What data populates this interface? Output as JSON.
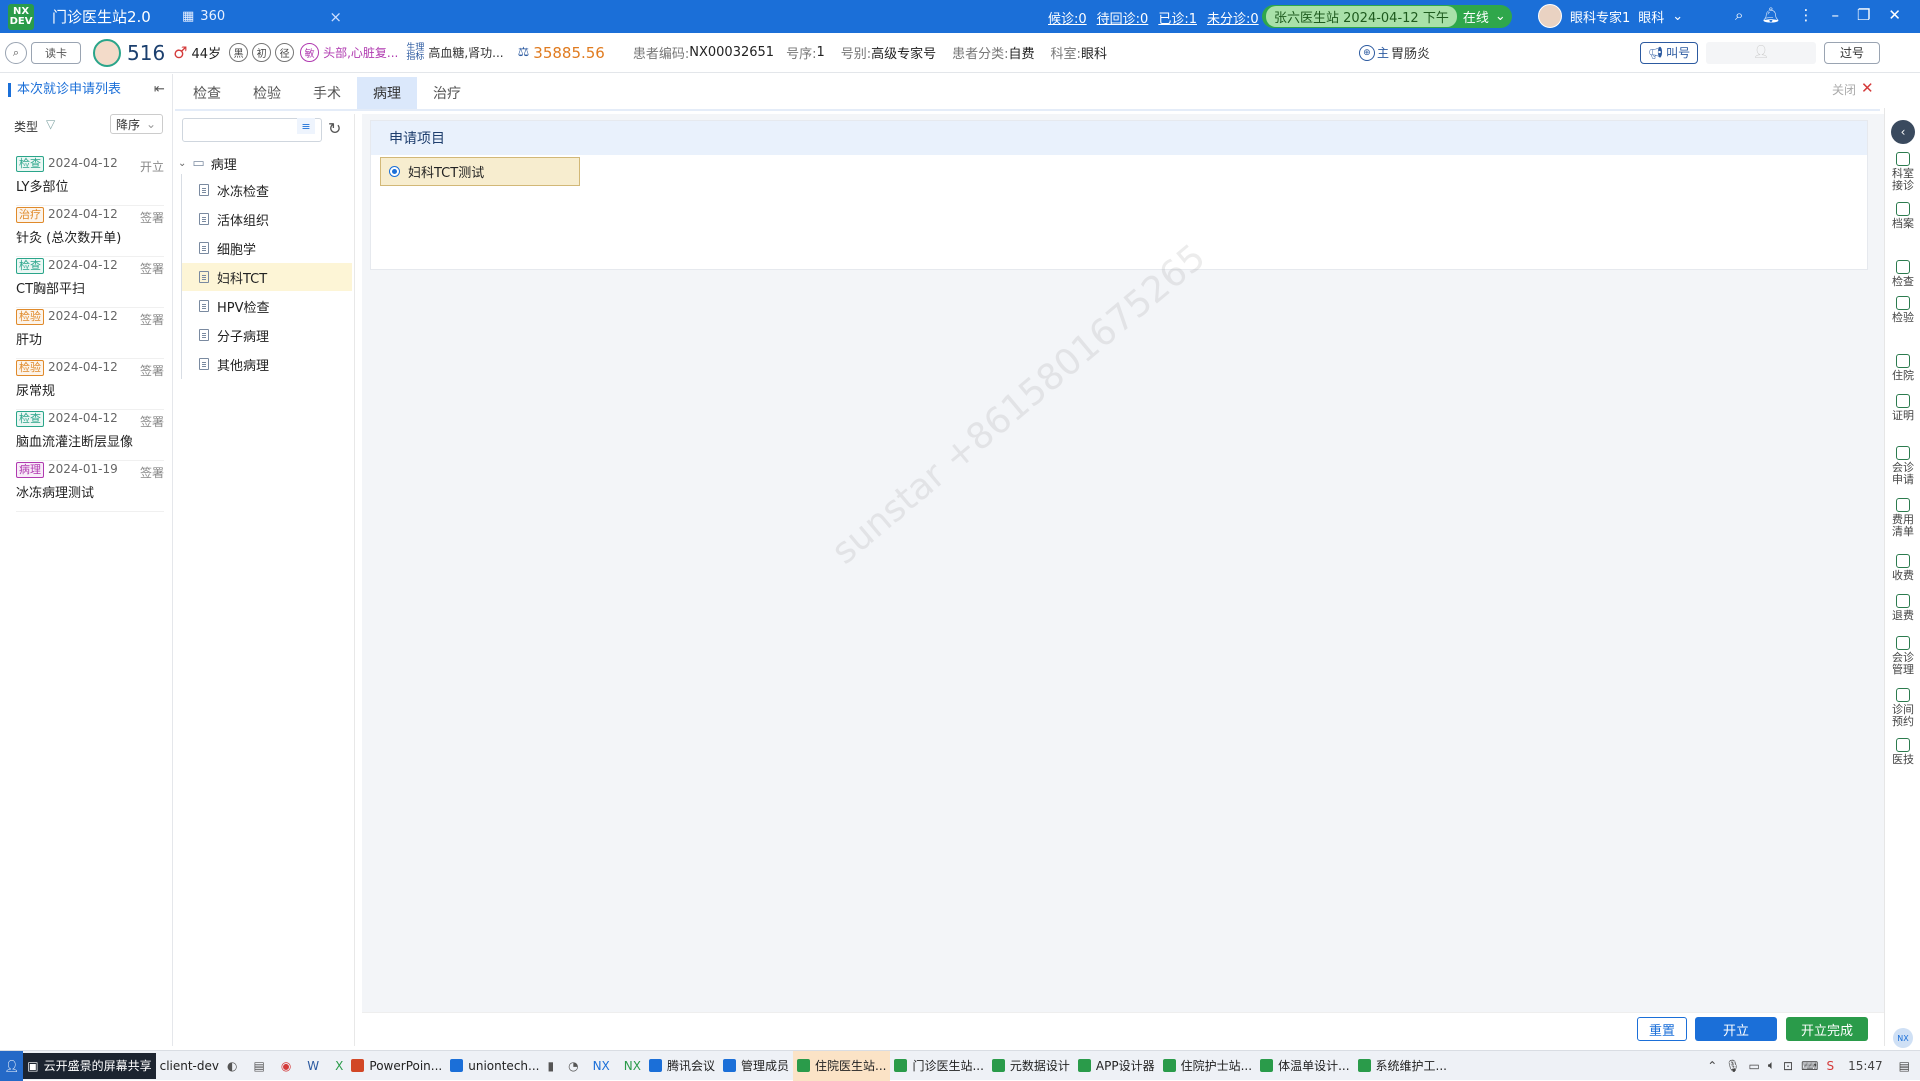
{
  "titlebar": {
    "logo_text": "NX DEV",
    "app_title": "门诊医生站2.0",
    "tab_label": "360",
    "queue_waiting": "候诊:0",
    "queue_return": "待回诊:0",
    "queue_done": "已诊:1",
    "queue_unassigned": "未分诊:0",
    "station": "张六医生站 2024-04-12 下午",
    "status": "在线",
    "user_name": "眼科专家1",
    "user_dept": "眼科"
  },
  "patient": {
    "search_label": "读卡",
    "number": "516",
    "gender_symbol": "♂",
    "age": "44岁",
    "badge1": "黑",
    "badge2": "初",
    "badge3": "径",
    "badge4": "敏",
    "allergy": "头部,心脏复...",
    "diag_label1": "生理",
    "diag_label2": "指标",
    "chronic": "高血糖,肾功...",
    "balance": "35885.56",
    "code_label": "患者编码:",
    "code": "NX00032651",
    "seq_label": "号序:",
    "seq": "1",
    "type_label": "号别:",
    "type": "高级专家号",
    "class_label": "患者分类:",
    "class": "自费",
    "dept_label": "科室:",
    "dept": "眼科",
    "diag_main_badge": "主",
    "diag_main": "胃肠炎",
    "call_button": "叫号",
    "pass_button": "过号"
  },
  "left_panel": {
    "title": "本次就诊申请列表",
    "filter_label": "类型",
    "sort_label": "降序",
    "items": [
      {
        "tag": "检查",
        "color": "#2aa58a",
        "date": "2024-04-12",
        "status": "开立",
        "name": "LY多部位"
      },
      {
        "tag": "治疗",
        "color": "#e08a2a",
        "date": "2024-04-12",
        "status": "签署",
        "name": "针灸 (总次数开单)"
      },
      {
        "tag": "检查",
        "color": "#2aa58a",
        "date": "2024-04-12",
        "status": "签署",
        "name": "CT胸部平扫"
      },
      {
        "tag": "检验",
        "color": "#e08a2a",
        "date": "2024-04-12",
        "status": "签署",
        "name": "肝功"
      },
      {
        "tag": "检验",
        "color": "#e08a2a",
        "date": "2024-04-12",
        "status": "签署",
        "name": "尿常规"
      },
      {
        "tag": "检查",
        "color": "#2aa58a",
        "date": "2024-04-12",
        "status": "签署",
        "name": "脑血流灌注断层显像"
      },
      {
        "tag": "病理",
        "color": "#b03ab0",
        "date": "2024-01-19",
        "status": "签署",
        "name": "冰冻病理测试"
      }
    ]
  },
  "tabs": [
    "检查",
    "检验",
    "手术",
    "病理",
    "治疗"
  ],
  "tree": {
    "root": "病理",
    "children": [
      "冰冻检查",
      "活体组织",
      "细胞学",
      "妇科TCT",
      "HPV检查",
      "分子病理",
      "其他病理"
    ]
  },
  "main": {
    "close_label": "关闭",
    "card_title": "申请项目",
    "selected_item": "妇科TCT测试",
    "watermark": "sunstar +8615801675265",
    "reset_button": "重置",
    "open_button": "开立",
    "open_done_button": "开立完成"
  },
  "right_sidebar": [
    "科室接诊",
    "档案",
    "检查",
    "检验",
    "住院",
    "证明",
    "会诊申请",
    "费用清单",
    "收费",
    "退费",
    "会诊管理",
    "诊间预约",
    "医技"
  ],
  "taskbar": {
    "items": [
      "云开盛景的屏幕共享",
      "client-dev",
      "PowerPoin...",
      "uniontech...",
      "腾讯会议",
      "管理成员",
      "住院医生站...",
      "门诊医生站...",
      "元数据设计",
      "APP设计器",
      "住院护士站...",
      "体温单设计...",
      "系统维护工..."
    ],
    "time": "15:47"
  }
}
